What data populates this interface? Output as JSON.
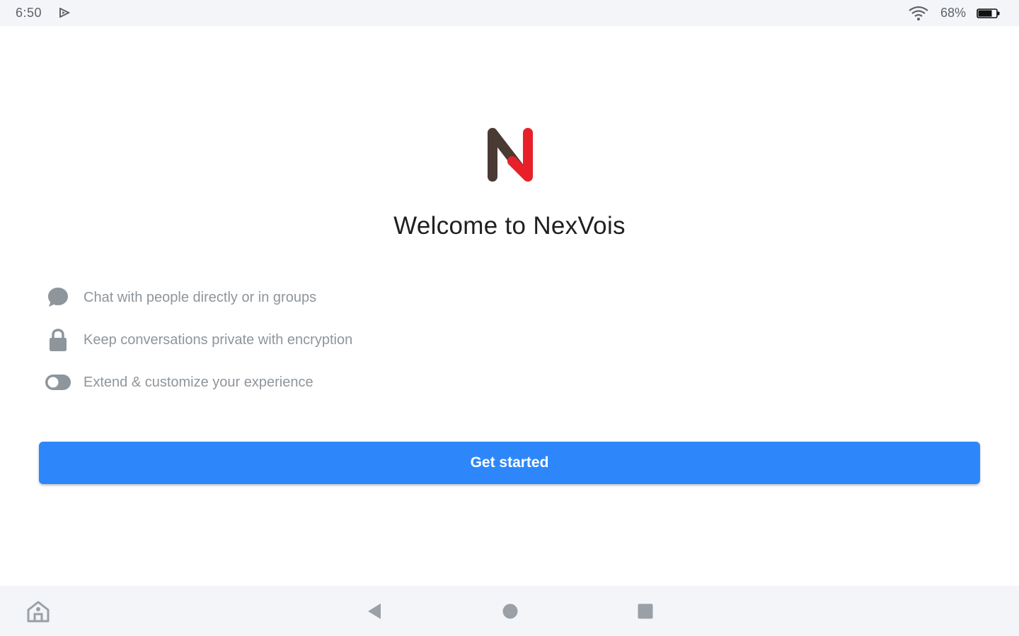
{
  "status_bar": {
    "time": "6:50",
    "battery_percent": "68%",
    "icons": [
      "play-icon",
      "wifi-icon",
      "battery-icon"
    ]
  },
  "welcome": {
    "logo_icon": "nexvois-logo",
    "title": "Welcome to NexVois"
  },
  "features": [
    {
      "icon": "chat-bubble-icon",
      "label": "Chat with people directly or in groups"
    },
    {
      "icon": "lock-icon",
      "label": "Keep conversations private with encryption"
    },
    {
      "icon": "toggle-icon",
      "label": "Extend & customize your experience"
    }
  ],
  "cta": {
    "label": "Get started",
    "color": "#2d87fa"
  },
  "nav_bar": {
    "icons": [
      "home-app-icon",
      "back-icon",
      "home-icon",
      "recents-icon"
    ]
  },
  "colors": {
    "logo_dark": "#4a3a34",
    "logo_red": "#e8202a",
    "feature_icon": "#8e959b",
    "background": "#ffffff",
    "system_bar": "#f3f5f9"
  }
}
